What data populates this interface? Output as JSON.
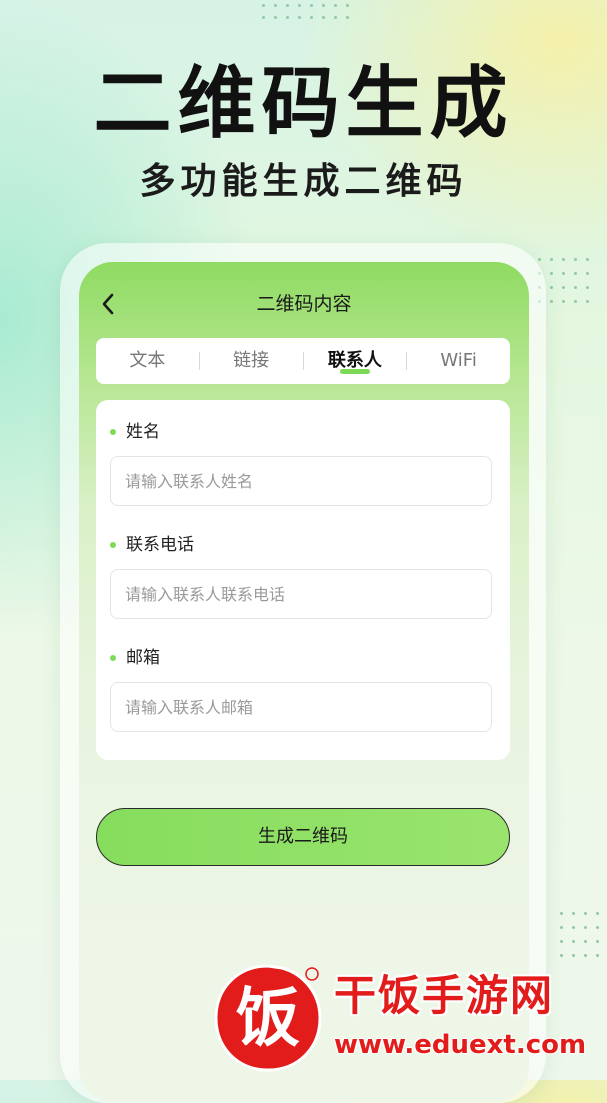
{
  "hero": {
    "title": "二维码生成",
    "subtitle": "多功能生成二维码"
  },
  "nav": {
    "back_icon": "chevron-left-icon",
    "title": "二维码内容"
  },
  "tabs": [
    {
      "label": "文本",
      "active": false
    },
    {
      "label": "链接",
      "active": false
    },
    {
      "label": "联系人",
      "active": true
    },
    {
      "label": "WiFi",
      "active": false
    }
  ],
  "form": {
    "fields": [
      {
        "label": "姓名",
        "value": "",
        "placeholder": "请输入联系人姓名"
      },
      {
        "label": "联系电话",
        "value": "",
        "placeholder": "请输入联系人联系电话"
      },
      {
        "label": "邮箱",
        "value": "",
        "placeholder": "请输入联系人邮箱"
      }
    ]
  },
  "generate_button": {
    "label": "生成二维码"
  },
  "watermark": {
    "logo_char": "饭",
    "brand": "干饭手游网",
    "url": "www.eduext.com",
    "color": "#e21b1b"
  },
  "colors": {
    "accent": "#7ed957",
    "button": "#8fdf64"
  }
}
